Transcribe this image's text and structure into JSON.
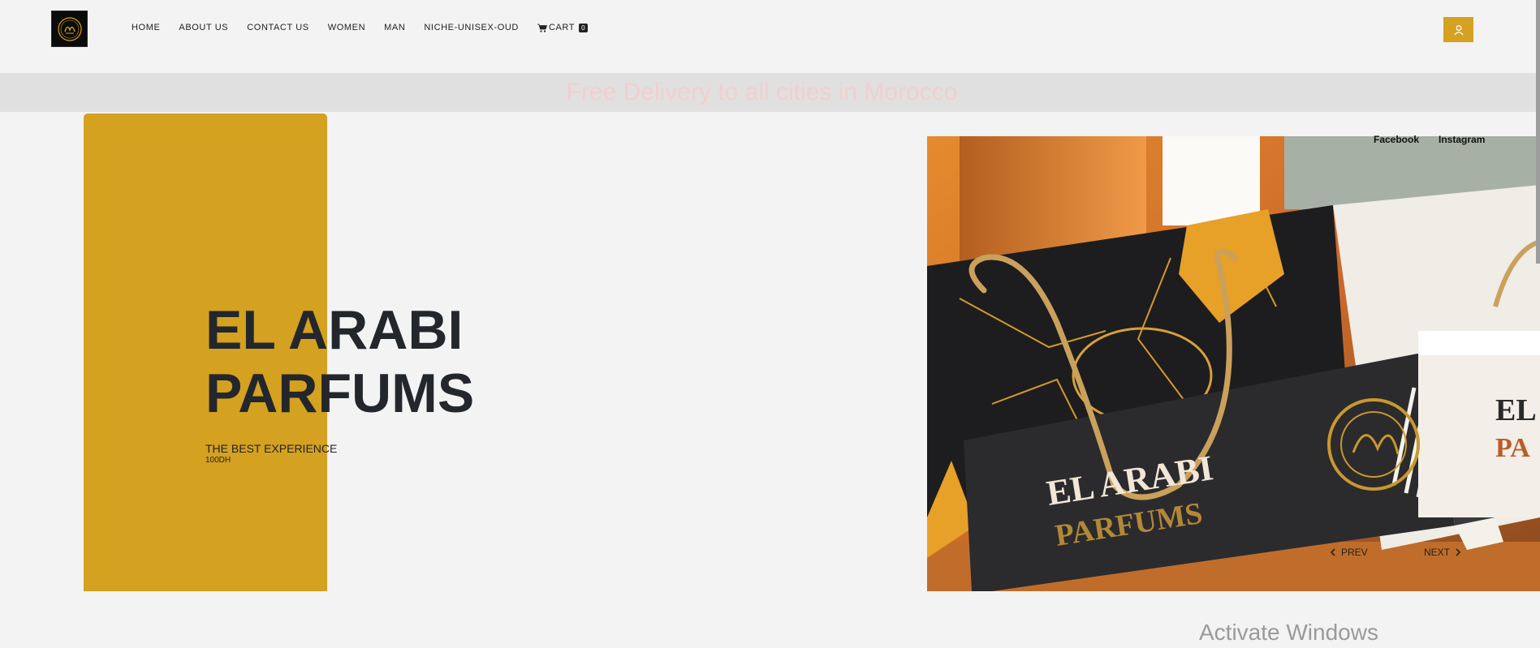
{
  "header": {
    "nav": [
      "HOME",
      "ABOUT US",
      "CONTACT US",
      "WOMEN",
      "MAN",
      "NICHE-UNISEX-OUD"
    ],
    "cart_label": "CART",
    "cart_count": "0"
  },
  "banner": {
    "text": "Free Delivery to all cities in Morocco"
  },
  "hero": {
    "title_line1": "EL ARABI",
    "title_line2": "PARFUMS",
    "subtitle": "THE BEST EXPERIENCE",
    "price": "100DH",
    "box_title": "EL ARABI",
    "box_subtitle": "PARFUMS",
    "side_box_text1": "EL",
    "side_box_text2": "PA"
  },
  "social": {
    "facebook": "Facebook",
    "instagram": "Instagram"
  },
  "slider": {
    "prev": "PREV",
    "next": "NEXT"
  },
  "overlay": {
    "activate_windows": "Activate Windows"
  },
  "colors": {
    "accent": "#d4a120",
    "banner_bg": "#e0e0e0",
    "banner_text": "#f2cfcf"
  },
  "icons": [
    "logo-emblem",
    "cart-icon",
    "user-icon",
    "chevron-left-icon",
    "chevron-right-icon"
  ]
}
